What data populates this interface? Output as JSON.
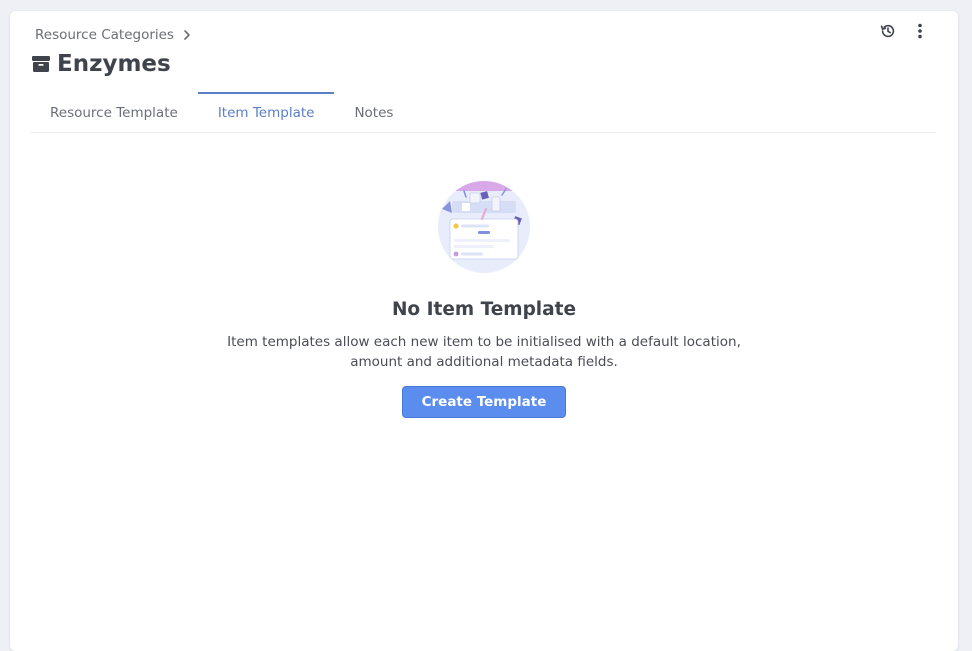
{
  "breadcrumb": {
    "parent_label": "Resource Categories"
  },
  "header": {
    "title": "Enzymes",
    "title_icon": "box-icon",
    "actions": [
      "history-icon",
      "more-vertical-icon"
    ]
  },
  "tabs": [
    {
      "label": "Resource Template",
      "active": false
    },
    {
      "label": "Item Template",
      "active": true
    },
    {
      "label": "Notes",
      "active": false
    }
  ],
  "empty_state": {
    "title": "No Item Template",
    "description": "Item templates allow each new item to be initialised with a default location, amount and additional metadata fields.",
    "button_label": "Create Template"
  },
  "colors": {
    "accent": "#5a7fc6",
    "button": "#5b8def",
    "text": "#3f434c"
  }
}
